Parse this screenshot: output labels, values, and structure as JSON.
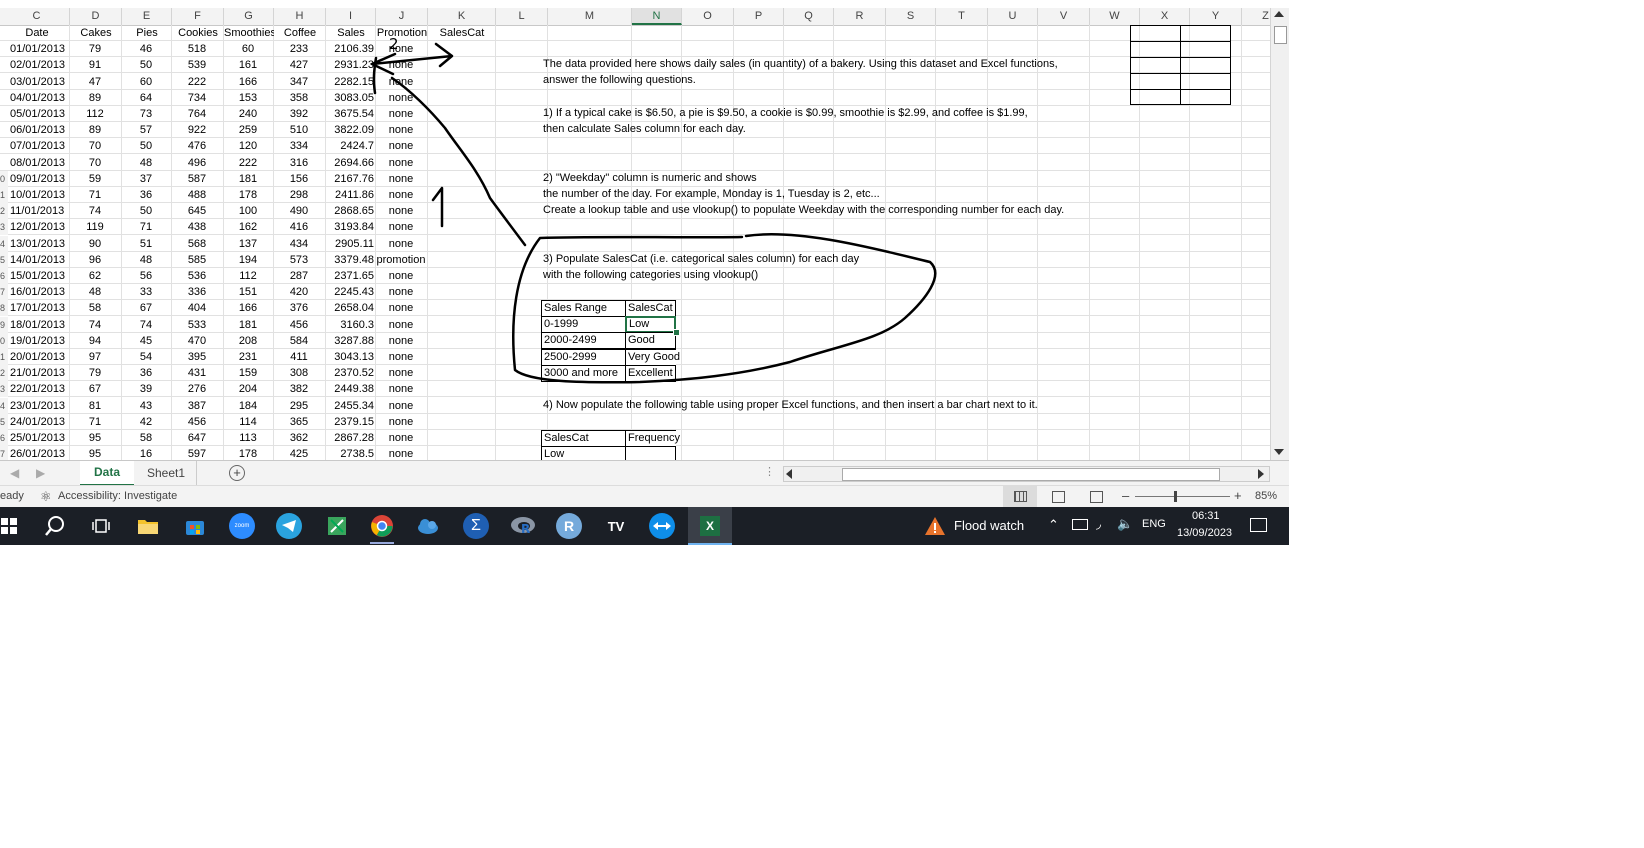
{
  "columns": [
    {
      "label": "C",
      "w": 66
    },
    {
      "label": "D",
      "w": 52
    },
    {
      "label": "E",
      "w": 50
    },
    {
      "label": "F",
      "w": 52
    },
    {
      "label": "G",
      "w": 50
    },
    {
      "label": "H",
      "w": 52
    },
    {
      "label": "I",
      "w": 50
    },
    {
      "label": "J",
      "w": 52
    },
    {
      "label": "K",
      "w": 68
    },
    {
      "label": "L",
      "w": 52
    },
    {
      "label": "M",
      "w": 84
    },
    {
      "label": "N",
      "w": 50
    },
    {
      "label": "O",
      "w": 52
    },
    {
      "label": "P",
      "w": 50
    },
    {
      "label": "Q",
      "w": 50
    },
    {
      "label": "R",
      "w": 52
    },
    {
      "label": "S",
      "w": 50
    },
    {
      "label": "T",
      "w": 52
    },
    {
      "label": "U",
      "w": 50
    },
    {
      "label": "V",
      "w": 52
    },
    {
      "label": "W",
      "w": 50
    },
    {
      "label": "X",
      "w": 50
    },
    {
      "label": "Y",
      "w": 52
    },
    {
      "label": "Z",
      "w": 48
    }
  ],
  "selected_column": "N",
  "headers": [
    "Date",
    "Cakes",
    "Pies",
    "Cookies",
    "Smoothies",
    "Coffee",
    "Sales",
    "Promotion",
    "SalesCat"
  ],
  "rows": [
    [
      "01/01/2013",
      "79",
      "46",
      "518",
      "60",
      "233",
      "2106.39",
      "none"
    ],
    [
      "02/01/2013",
      "91",
      "50",
      "539",
      "161",
      "427",
      "2931.23",
      "none"
    ],
    [
      "03/01/2013",
      "47",
      "60",
      "222",
      "166",
      "347",
      "2282.15",
      "none"
    ],
    [
      "04/01/2013",
      "89",
      "64",
      "734",
      "153",
      "358",
      "3083.05",
      "none"
    ],
    [
      "05/01/2013",
      "112",
      "73",
      "764",
      "240",
      "392",
      "3675.54",
      "none"
    ],
    [
      "06/01/2013",
      "89",
      "57",
      "922",
      "259",
      "510",
      "3822.09",
      "none"
    ],
    [
      "07/01/2013",
      "70",
      "50",
      "476",
      "120",
      "334",
      "2424.7",
      "none"
    ],
    [
      "08/01/2013",
      "70",
      "48",
      "496",
      "222",
      "316",
      "2694.66",
      "none"
    ],
    [
      "09/01/2013",
      "59",
      "37",
      "587",
      "181",
      "156",
      "2167.76",
      "none"
    ],
    [
      "10/01/2013",
      "71",
      "36",
      "488",
      "178",
      "298",
      "2411.86",
      "none"
    ],
    [
      "11/01/2013",
      "74",
      "50",
      "645",
      "100",
      "490",
      "2868.65",
      "none"
    ],
    [
      "12/01/2013",
      "119",
      "71",
      "438",
      "162",
      "416",
      "3193.84",
      "none"
    ],
    [
      "13/01/2013",
      "90",
      "51",
      "568",
      "137",
      "434",
      "2905.11",
      "none"
    ],
    [
      "14/01/2013",
      "96",
      "48",
      "585",
      "194",
      "573",
      "3379.48",
      "promotion"
    ],
    [
      "15/01/2013",
      "62",
      "56",
      "536",
      "112",
      "287",
      "2371.65",
      "none"
    ],
    [
      "16/01/2013",
      "48",
      "33",
      "336",
      "151",
      "420",
      "2245.43",
      "none"
    ],
    [
      "17/01/2013",
      "58",
      "67",
      "404",
      "166",
      "376",
      "2658.04",
      "none"
    ],
    [
      "18/01/2013",
      "74",
      "74",
      "533",
      "181",
      "456",
      "3160.3",
      "none"
    ],
    [
      "19/01/2013",
      "94",
      "45",
      "470",
      "208",
      "584",
      "3287.88",
      "none"
    ],
    [
      "20/01/2013",
      "97",
      "54",
      "395",
      "231",
      "411",
      "3043.13",
      "none"
    ],
    [
      "21/01/2013",
      "79",
      "36",
      "431",
      "159",
      "308",
      "2370.52",
      "none"
    ],
    [
      "22/01/2013",
      "67",
      "39",
      "276",
      "204",
      "382",
      "2449.38",
      "none"
    ],
    [
      "23/01/2013",
      "81",
      "43",
      "387",
      "184",
      "295",
      "2455.34",
      "none"
    ],
    [
      "24/01/2013",
      "71",
      "42",
      "456",
      "114",
      "365",
      "2379.15",
      "none"
    ],
    [
      "25/01/2013",
      "95",
      "58",
      "647",
      "113",
      "362",
      "2867.28",
      "none"
    ],
    [
      "26/01/2013",
      "95",
      "16",
      "597",
      "178",
      "425",
      "2738.5",
      "none"
    ]
  ],
  "row_stubs": [
    "",
    "",
    "",
    "",
    "",
    "",
    "",
    "",
    "",
    "0",
    "1",
    "2",
    "3",
    "4",
    "5",
    "6",
    "7",
    "8",
    "9",
    "0",
    "1",
    "2",
    "3",
    "4",
    "5",
    "6",
    "7"
  ],
  "notes": [
    "The data provided here shows daily sales (in quantity) of a bakery. Using this dataset and Excel functions,",
    "answer the following questions.",
    "1) If a typical cake is $6.50, a pie is $9.50, a cookie is $0.99, smoothie is $2.99, and coffee is $1.99,",
    "then calculate Sales column for each day.",
    "2) \"Weekday\" column is numeric and shows",
    "the number of the day. For example, Monday is 1, Tuesday is 2, etc...",
    "Create a lookup table and  use vlookup() to populate Weekday with the corresponding number for each day.",
    "3) Populate SalesCat (i.e. categorical sales column) for each day",
    "with the following categories using vlookup()",
    "4) Now populate the following table using proper Excel functions, and then insert a bar chart next to it."
  ],
  "lookup_table": {
    "header": [
      "Sales Range",
      "SalesCat"
    ],
    "rows": [
      [
        "0-1999",
        "Low"
      ],
      [
        "2000-2499",
        "Good"
      ],
      [
        "2500-2999",
        "Very Good"
      ],
      [
        "3000 and more",
        "Excellent"
      ]
    ]
  },
  "freq_table": {
    "header": [
      "SalesCat",
      "Frequency"
    ],
    "rows": [
      [
        "Low",
        ""
      ]
    ]
  },
  "sheet_tabs": [
    "Data",
    "Sheet1"
  ],
  "active_tab": "Data",
  "status": {
    "ready": "eady",
    "accessibility": "Accessibility: Investigate",
    "zoom": "85%"
  },
  "taskbar": {
    "weather": "Flood watch",
    "lang": "ENG",
    "time": "06:31",
    "date": "13/09/2023",
    "zoom_icon_text": "zoom",
    "r_icon_text": "R",
    "tv_icon_text": "TV",
    "excel_icon_text": "X",
    "sigma_icon_text": "Σ"
  },
  "ink_annotations": [
    "2",
    "1"
  ]
}
